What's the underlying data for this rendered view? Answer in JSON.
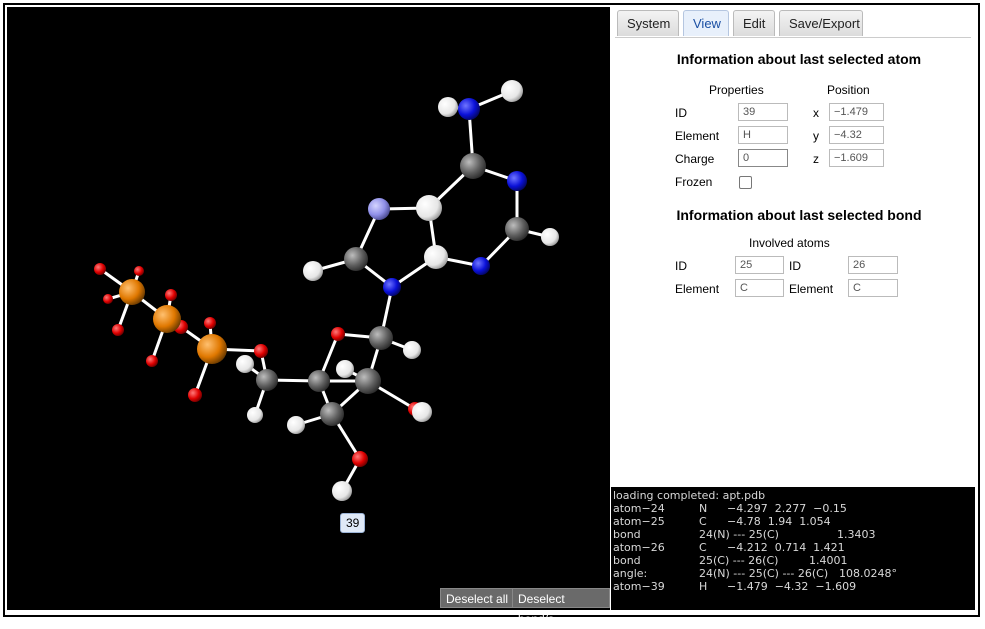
{
  "tabs": [
    {
      "label": "System",
      "active": false
    },
    {
      "label": "View",
      "active": true
    },
    {
      "label": "Edit",
      "active": false
    },
    {
      "label": "Save/Export",
      "active": false
    }
  ],
  "atom_info": {
    "title": "Information about last selected atom",
    "properties_heading": "Properties",
    "position_heading": "Position",
    "id_label": "ID",
    "id_value": "39",
    "element_label": "Element",
    "element_value": "H",
    "charge_label": "Charge",
    "charge_value": "0",
    "frozen_label": "Frozen",
    "frozen_checked": false,
    "x_label": "x",
    "x_value": "−1.479",
    "y_label": "y",
    "y_value": "−4.32",
    "z_label": "z",
    "z_value": "−1.609"
  },
  "bond_info": {
    "title": "Information about last selected bond",
    "involved_heading": "Involved atoms",
    "id_label": "ID",
    "element_label": "Element",
    "atom1_id": "25",
    "atom1_element": "C",
    "atom2_id": "26",
    "atom2_element": "C"
  },
  "viewer": {
    "selected_atom_label": "39",
    "deselect_all_label": "Deselect all",
    "deselect_bonds_label": "Deselect bond/s"
  },
  "console": {
    "lines": [
      {
        "c1": "loading completed: apt.pdb",
        "c2": "",
        "c3": ""
      },
      {
        "c1": "atom−24",
        "c2": "N",
        "c3": "−4.297  2.277  −0.15"
      },
      {
        "c1": "atom−25",
        "c2": "C",
        "c3": "−4.78  1.94  1.054"
      },
      {
        "c1": "bond",
        "c2": "24(N) --- 25(C)",
        "c3": "1.3403"
      },
      {
        "c1": "atom−26",
        "c2": "C",
        "c3": "−4.212  0.714  1.421"
      },
      {
        "c1": "bond",
        "c2": "25(C) --- 26(C)",
        "c3": "1.4001"
      },
      {
        "c1": "angle:",
        "c2": "24(N) --- 25(C) --- 26(C)",
        "c3": "108.0248°"
      },
      {
        "c1": "atom−39",
        "c2": "H",
        "c3": "−1.479  −4.32  −1.609"
      }
    ]
  },
  "colors": {
    "carbon": "#5f5f5f",
    "hydrogen": "#f0f0f0",
    "nitrogen": "#0a10d8",
    "oxygen": "#e00000",
    "phosphorus": "#e07800",
    "highlighted": "#8f8fe8",
    "bond": "#ffffff"
  }
}
